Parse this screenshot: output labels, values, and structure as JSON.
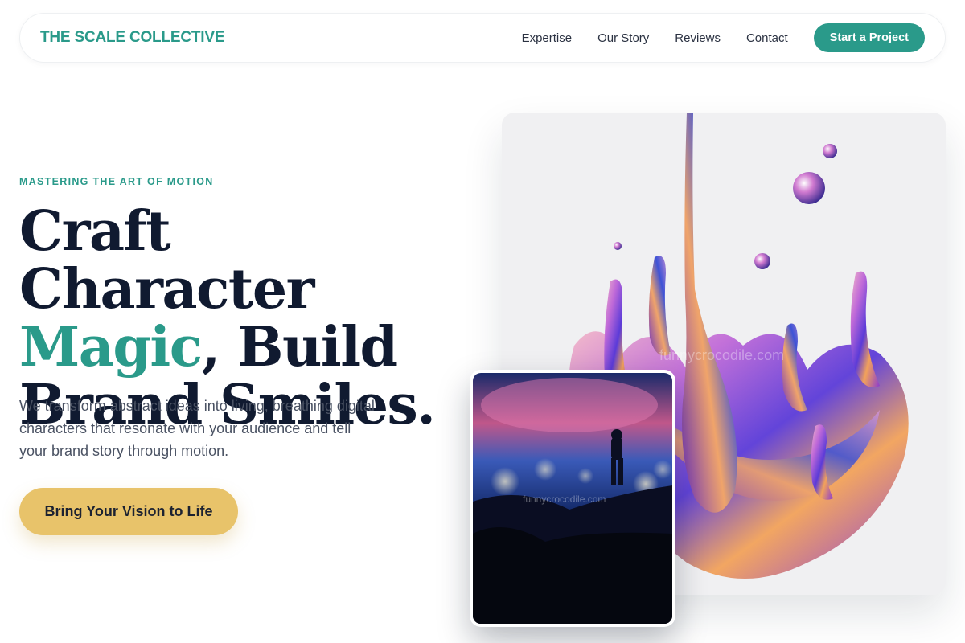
{
  "nav": {
    "brand": "THE SCALE COLLECTIVE",
    "links": [
      "Expertise",
      "Our Story",
      "Reviews",
      "Contact"
    ],
    "cta_label": "Start a Project"
  },
  "hero": {
    "eyebrow": "MASTERING THE ART OF MOTION",
    "headline_line1": "Craft Character",
    "headline_accent": "Magic",
    "headline_line2_rest": ", Build",
    "headline_line3": "Brand Smiles.",
    "subtext": "We transform abstract ideas into living, breathing digital characters that resonate with your audience and tell your brand story through motion.",
    "cta_label": "Bring Your Vision to Life"
  },
  "images": {
    "main_art_watermark": "funnycrocodile.com",
    "night_watermark": "funnycrocodile.com"
  },
  "colors": {
    "accent": "#2a9a8a",
    "headline": "#101a30",
    "cta_gold": "#e8c36a",
    "body_text": "#4a5263"
  }
}
